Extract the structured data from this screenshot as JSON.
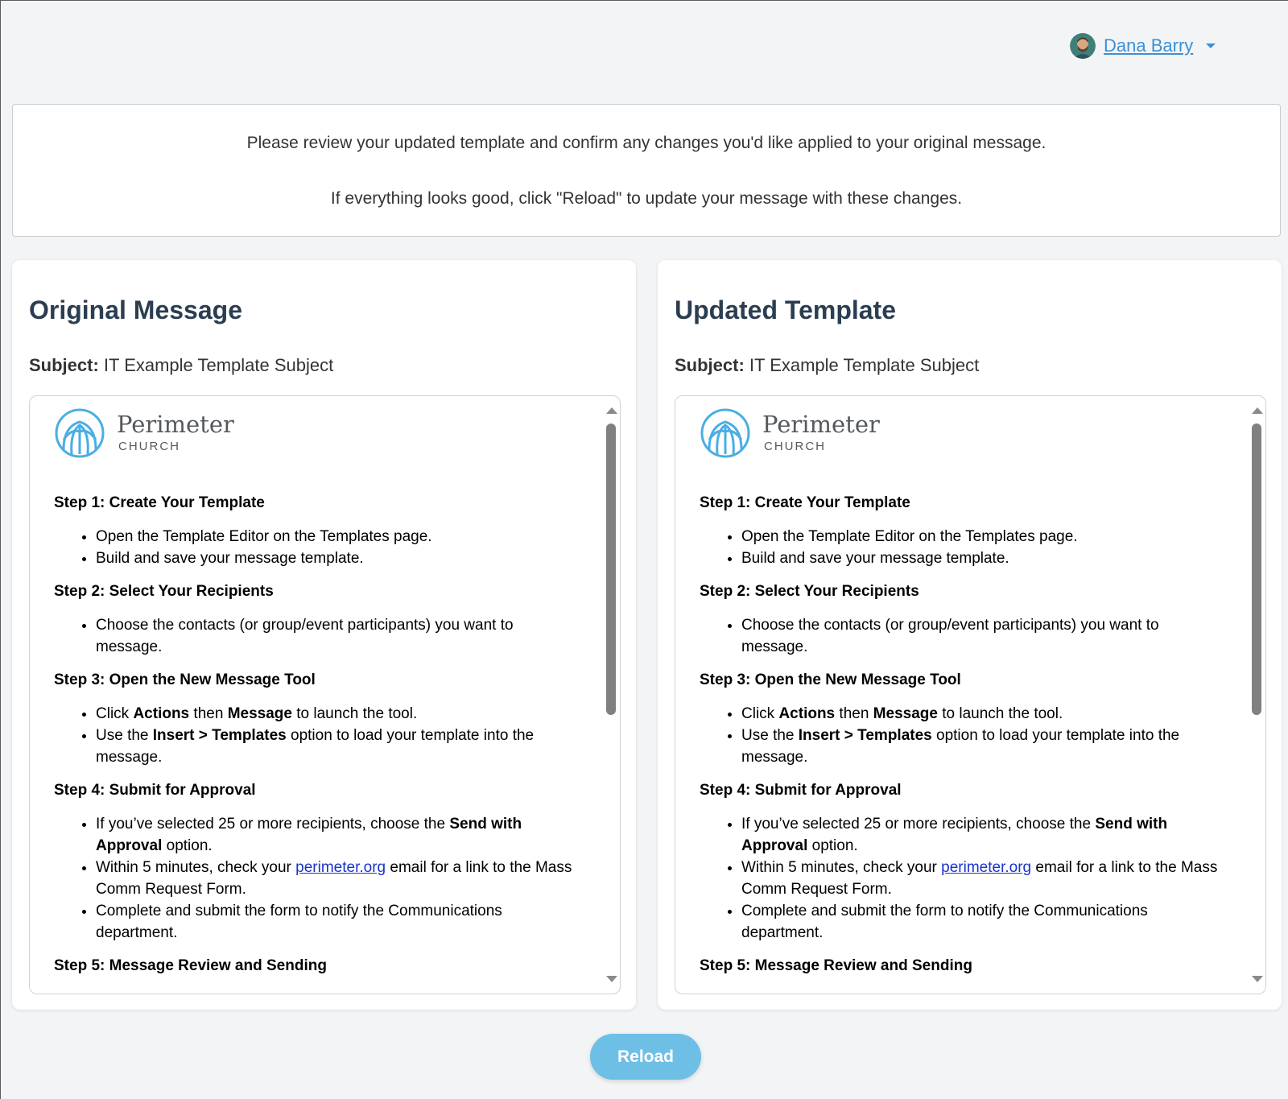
{
  "user": {
    "name": "Dana Barry",
    "icon": "caret-down-icon"
  },
  "notice": {
    "line1": "Please review your updated template and confirm any changes you'd like applied to your original message.",
    "line2": "If everything looks good, click \"Reload\" to update your message with these changes."
  },
  "panels": [
    {
      "title": "Original Message",
      "subject_label": "Subject:",
      "subject": "IT Example Template Subject"
    },
    {
      "title": "Updated Template",
      "subject_label": "Subject:",
      "subject": "IT Example Template Subject"
    }
  ],
  "email": {
    "logo": {
      "name": "Perimeter",
      "tag": "CHURCH"
    },
    "step1": {
      "title": "Step 1: Create Your Template",
      "b1": "Open the Template Editor on the Templates page.",
      "b2": "Build and save your message template."
    },
    "step2": {
      "title": "Step 2: Select Your Recipients",
      "b1": "Choose the contacts (or group/event participants) you want to message."
    },
    "step3": {
      "title": "Step 3: Open the New Message Tool",
      "b1_pre": "Click ",
      "b1_bold1": "Actions",
      "b1_mid": " then ",
      "b1_bold2": "Message",
      "b1_post": " to launch the tool.",
      "b2_pre": "Use the ",
      "b2_bold1": "Insert > Templates",
      "b2_post": " option to load your template into the message."
    },
    "step4": {
      "title": "Step 4: Submit for Approval",
      "b1_pre": "If you’ve selected 25 or more recipients, choose the ",
      "b1_bold": "Send with Approval",
      "b1_post": " option.",
      "b2_pre": "Within 5 minutes, check your ",
      "b2_link": "perimeter.org",
      "b2_post": " email for a link to the Mass Comm Request Form.",
      "b3": "Complete and submit the form to notify the Communications department."
    },
    "step5": {
      "title": "Step 5: Message Review and Sending"
    }
  },
  "actions": {
    "reload_label": "Reload"
  },
  "colors": {
    "accent": "#6ebfe6",
    "link": "#3d8fd6",
    "heading": "#2b3e51",
    "logo_blue": "#4aaee3"
  }
}
